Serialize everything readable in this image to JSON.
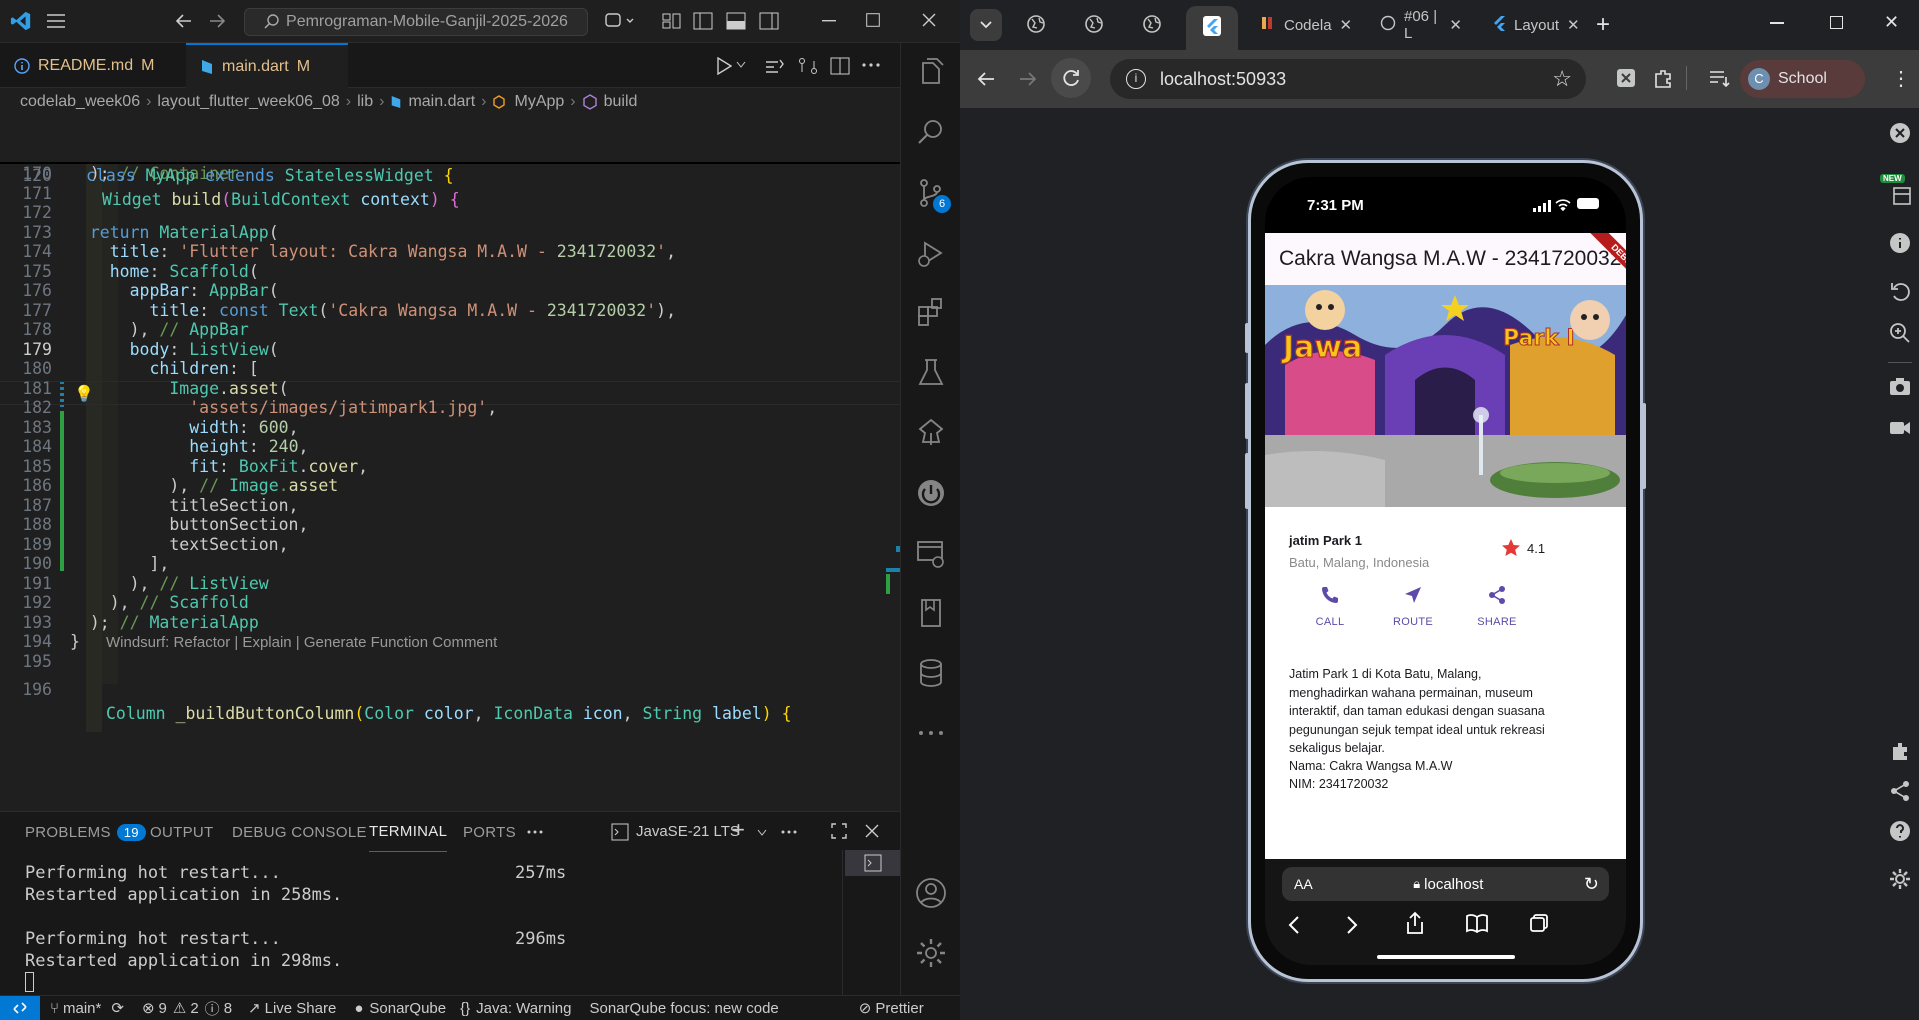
{
  "vscode": {
    "search": "Pemrograman-Mobile-Ganjil-2025-2026",
    "tabs": [
      {
        "label": "README.md",
        "badge": "M"
      },
      {
        "label": "main.dart",
        "badge": "M"
      }
    ],
    "breadcrumb": [
      "codelab_week06",
      "layout_flutter_week06_08",
      "lib",
      "main.dart",
      "MyApp",
      "build"
    ],
    "sticky": [
      {
        "ln": "116",
        "code": "class MyApp extends StatelessWidget {"
      },
      {
        "ln": "120",
        "code": "Widget build(BuildContext context) {"
      }
    ],
    "lines": [
      {
        "ln": "170",
        "code": "  ); // Container"
      },
      {
        "ln": "171",
        "code": ""
      },
      {
        "ln": "172",
        "code": ""
      },
      {
        "ln": "173",
        "code": "  return MaterialApp("
      },
      {
        "ln": "174",
        "code": "    title: 'Flutter layout: Cakra Wangsa M.A.W - 2341720032',"
      },
      {
        "ln": "175",
        "code": "    home: Scaffold("
      },
      {
        "ln": "176",
        "code": "      appBar: AppBar("
      },
      {
        "ln": "177",
        "code": "        title: const Text('Cakra Wangsa M.A.W - 2341720032'),"
      },
      {
        "ln": "178",
        "code": "      ), // AppBar"
      },
      {
        "ln": "179",
        "code": "      body: ListView("
      },
      {
        "ln": "180",
        "code": "        children: ["
      },
      {
        "ln": "181",
        "code": "          Image.asset("
      },
      {
        "ln": "182",
        "code": "            'assets/images/jatimpark1.jpg',"
      },
      {
        "ln": "183",
        "code": "            width: 600,"
      },
      {
        "ln": "184",
        "code": "            height: 240,"
      },
      {
        "ln": "185",
        "code": "            fit: BoxFit.cover,"
      },
      {
        "ln": "186",
        "code": "          ), // Image.asset"
      },
      {
        "ln": "187",
        "code": "          titleSection,"
      },
      {
        "ln": "188",
        "code": "          buttonSection,"
      },
      {
        "ln": "189",
        "code": "          textSection,"
      },
      {
        "ln": "190",
        "code": "        ],"
      },
      {
        "ln": "191",
        "code": "      ), // ListView"
      },
      {
        "ln": "192",
        "code": "    ), // Scaffold"
      },
      {
        "ln": "193",
        "code": "  ); // MaterialApp"
      },
      {
        "ln": "194",
        "code": "}"
      },
      {
        "ln": "195",
        "code": ""
      }
    ],
    "codelens": "Windsurf: Refactor | Explain | Generate Function Comment",
    "line196": {
      "ln": "196",
      "code": "Column _buildButtonColumn(Color color, IconData icon, String label) {"
    },
    "panel_tabs": [
      "PROBLEMS",
      "OUTPUT",
      "DEBUG CONSOLE",
      "TERMINAL",
      "PORTS"
    ],
    "problems_count": "19",
    "terminal_name": "JavaSE-21 LTS",
    "terminal": [
      {
        "text": "Performing hot restart...",
        "time": "257ms"
      },
      {
        "text": "Restarted application in 258ms.",
        "time": ""
      },
      {
        "text": "",
        "time": ""
      },
      {
        "text": "Performing hot restart...",
        "time": "296ms"
      },
      {
        "text": "Restarted application in 298ms.",
        "time": ""
      }
    ],
    "scm_badge": "6",
    "status": {
      "branch": "main*",
      "errors": "9",
      "warnings": "2",
      "info": "8",
      "live_share": "Live Share",
      "sonar": "SonarQube",
      "java": "Java: Warning",
      "sonar_focus": "SonarQube focus: new code",
      "prettier": "Prettier"
    }
  },
  "chrome": {
    "tabs": [
      {
        "label": "Codela"
      },
      {
        "label": "#06 | L"
      },
      {
        "label": "Layout"
      }
    ],
    "url": "localhost:50933",
    "profile_initial": "C",
    "profile": "School"
  },
  "phone": {
    "time": "7:31 PM",
    "appbar_title": "Cakra Wangsa M.A.W - 2341720032",
    "debug": "DEBUG",
    "place_title": "jatim Park 1",
    "place_location": "Batu, Malang, Indonesia",
    "rating": "4.1",
    "buttons": [
      {
        "label": "CALL",
        "icon": "phone-icon"
      },
      {
        "label": "ROUTE",
        "icon": "navigation-icon"
      },
      {
        "label": "SHARE",
        "icon": "share-icon"
      }
    ],
    "description": "Jatim Park 1 di Kota Batu, Malang, menghadirkan wahana permainan, museum interaktif, dan taman edukasi dengan suasana pegunungan sejuk tempat ideal untuk rekreasi sekaligus belajar.",
    "name_line": "Nama: Cakra Wangsa M.A.W",
    "nim_line": "NIM: 2341720032",
    "safari_aa": "AA",
    "safari_url": "localhost"
  },
  "colors": {
    "accent": "#5e4aa8",
    "star": "#e53935",
    "vscode_blue": "#0078d4"
  }
}
